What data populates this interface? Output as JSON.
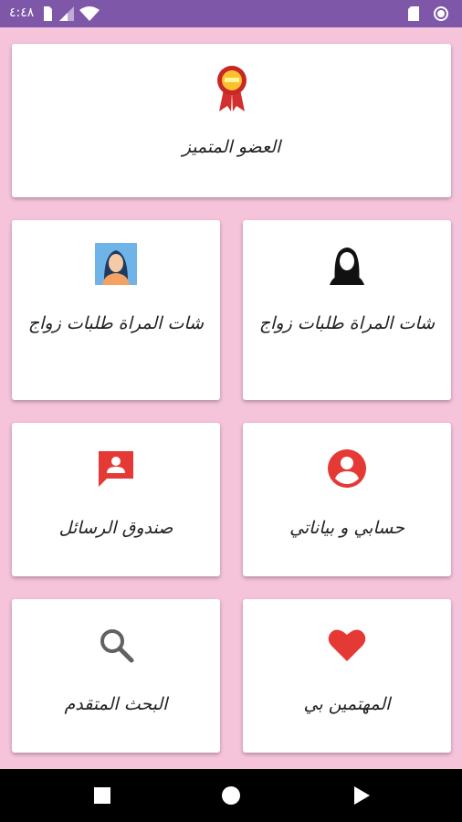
{
  "status_bar": {
    "time": "٤:٤٨",
    "icons": [
      "sim-icon",
      "signal-icon",
      "wifi-icon",
      "sd-card-icon",
      "sync-icon"
    ]
  },
  "cards": {
    "featured_member": {
      "label": "العضو المتميز",
      "icon": "award-ribbon-icon"
    },
    "women_chat_left": {
      "label": "شات المراة طلبات زواج",
      "icon": "woman-portrait-icon"
    },
    "women_chat_right": {
      "label": "شات المراة طلبات زواج",
      "icon": "woman-silhouette-icon"
    },
    "messages_box": {
      "label": "صندوق الرسائل",
      "icon": "message-person-icon"
    },
    "my_account": {
      "label": "حسابي و بياناتي",
      "icon": "account-circle-icon"
    },
    "advanced_search": {
      "label": "البحث المتقدم",
      "icon": "search-icon"
    },
    "interested_in_me": {
      "label": "المهتمين بي",
      "icon": "heart-icon"
    }
  },
  "colors": {
    "background": "#f5c3da",
    "status_bar": "#7e57a8",
    "accent_red": "#e53935",
    "search_gray": "#616161"
  },
  "nav_bar": {
    "buttons": [
      "recents-square-icon",
      "home-circle-icon",
      "back-triangle-icon"
    ]
  }
}
